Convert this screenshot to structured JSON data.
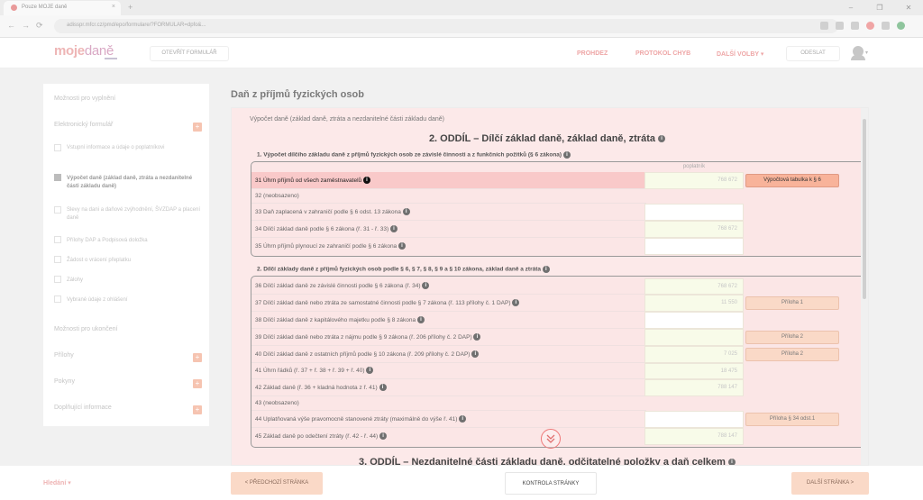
{
  "browser": {
    "tab_title": "Pouze MOJE daně",
    "tab_close": "×",
    "new_tab": "+",
    "url": "adisspr.mfcr.cz/pmd/epo/formulare/?FORMULAR=dpfo&...",
    "window_buttons": [
      "–",
      "❐",
      "✕"
    ],
    "nav": [
      "←",
      "→",
      "⟳"
    ]
  },
  "header": {
    "logo_main": "moje",
    "logo_sub": "daně",
    "load_form": "OTEVŘÍT FORMULÁŘ",
    "links": [
      "PROHDEZ",
      "PROTOKOL CHYB",
      "DALŠÍ VOLBY ▾"
    ],
    "submit": "ODESLAT",
    "avatar_caret": "▾"
  },
  "sidebar": {
    "items": [
      {
        "label": "Možnosti pro vyplnění"
      },
      {
        "label": "Elektronický formulář"
      },
      {
        "label": "Vstupní informace a údaje o poplatníkovi"
      },
      {
        "label": "Výpočet daně (základ daně, ztráta a nezdanitelné části základu daně)"
      },
      {
        "label": "Slevy na dani a daňové zvýhodnění, ŠVZDAP a placení daně"
      },
      {
        "label": "Přílohy DAP a Podpisová doložka"
      },
      {
        "label": "Žádost o vrácení přeplatku"
      },
      {
        "label": "Zálohy"
      },
      {
        "label": "Vybrané údaje z ohlášení"
      },
      {
        "label": "Možnosti pro ukončení"
      },
      {
        "label": "Přílohy"
      },
      {
        "label": "Pokyny"
      },
      {
        "label": "Doplňující informace"
      }
    ],
    "plus": "+"
  },
  "main": {
    "title": "Daň z příjmů fyzických osob",
    "subtitle": "Výpočet daně (základ daně, ztráta a nezdanitelné části základu daně)",
    "section2": "2. ODDÍL – Dílčí základ daně, základ daně, ztráta",
    "section3": "3. ODDÍL – Nezdanitelné části základu daně, odčitatelné položky a daň celkem",
    "info_glyph": "i",
    "box1": {
      "heading": "1. Výpočet dílčího základu daně z příjmů fyzických osob ze závislé činnosti a z funkčních požitků (§ 6 zákona)",
      "col_header": "poplatník",
      "rows": [
        {
          "label": "31 Úhrn příjmů od všech zaměstnavatelů",
          "value": "768 672"
        },
        {
          "label": "32 (neobsazeno)",
          "value": ""
        },
        {
          "label": "33 Daň zaplacená v zahraničí podle § 6 odst. 13 zákona",
          "value": ""
        },
        {
          "label": "34 Dílčí základ daně podle § 6 zákona (ř. 31 - ř. 33)",
          "value": "768 672"
        },
        {
          "label": "35 Úhrn příjmů plynoucí ze zahraničí podle § 6 zákona",
          "value": ""
        }
      ],
      "button": "Výpočtová tabulka k § 6"
    },
    "box2": {
      "heading": "2. Dílčí základy daně z příjmů fyzických osob podle § 6, § 7, § 8, § 9 a § 10 zákona, základ daně a ztráta",
      "rows": [
        {
          "label": "36 Dílčí základ daně ze závislé činnosti podle § 6 zákona (ř. 34)",
          "value": "768 672"
        },
        {
          "label": "37 Dílčí základ daně nebo ztráta ze samostatné činnosti podle § 7 zákona (ř. 113 přílohy č. 1 DAP)",
          "value": "11 550"
        },
        {
          "label": "38 Dílčí základ daně z kapitálového majetku podle § 8 zákona",
          "value": ""
        },
        {
          "label": "39 Dílčí základ daně nebo ztráta z nájmu podle § 9 zákona (ř. 206 přílohy č. 2 DAP)",
          "value": ""
        },
        {
          "label": "40 Dílčí základ daně z ostatních příjmů podle § 10 zákona (ř. 209 přílohy č. 2 DAP)",
          "value": "7 025"
        },
        {
          "label": "41 Úhrn řádků (ř. 37 + ř. 38 + ř. 39 + ř. 40)",
          "value": "18 475"
        },
        {
          "label": "42 Základ daně (ř. 36 + kladná hodnota z ř. 41)",
          "value": "788 147"
        },
        {
          "label": "43 (neobsazeno)",
          "value": ""
        },
        {
          "label": "44 Uplatňovaná výše pravomocně stanovené ztráty (maximálně do výše ř. 41)",
          "value": ""
        },
        {
          "label": "45 Základ daně po odečtení ztráty (ř. 42 - ř. 44)",
          "value": "788 147"
        }
      ],
      "buttons": [
        "Příloha 1",
        "Příloha 2",
        "Příloha 2",
        "Příloha § 34 odst.1"
      ]
    }
  },
  "footer": {
    "back_link": "Hledání ▾",
    "prev": "< PŘEDCHOZÍ STRÁNKA",
    "check": "KONTROLA STRÁNKY",
    "next": "DALŠÍ STRÁNKA >"
  },
  "colors": {
    "accent": "#ee9f9f",
    "panel_bg": "#fce9e9",
    "button_bg": "#fad9c7",
    "highlight_row": "#f9c9c9"
  }
}
